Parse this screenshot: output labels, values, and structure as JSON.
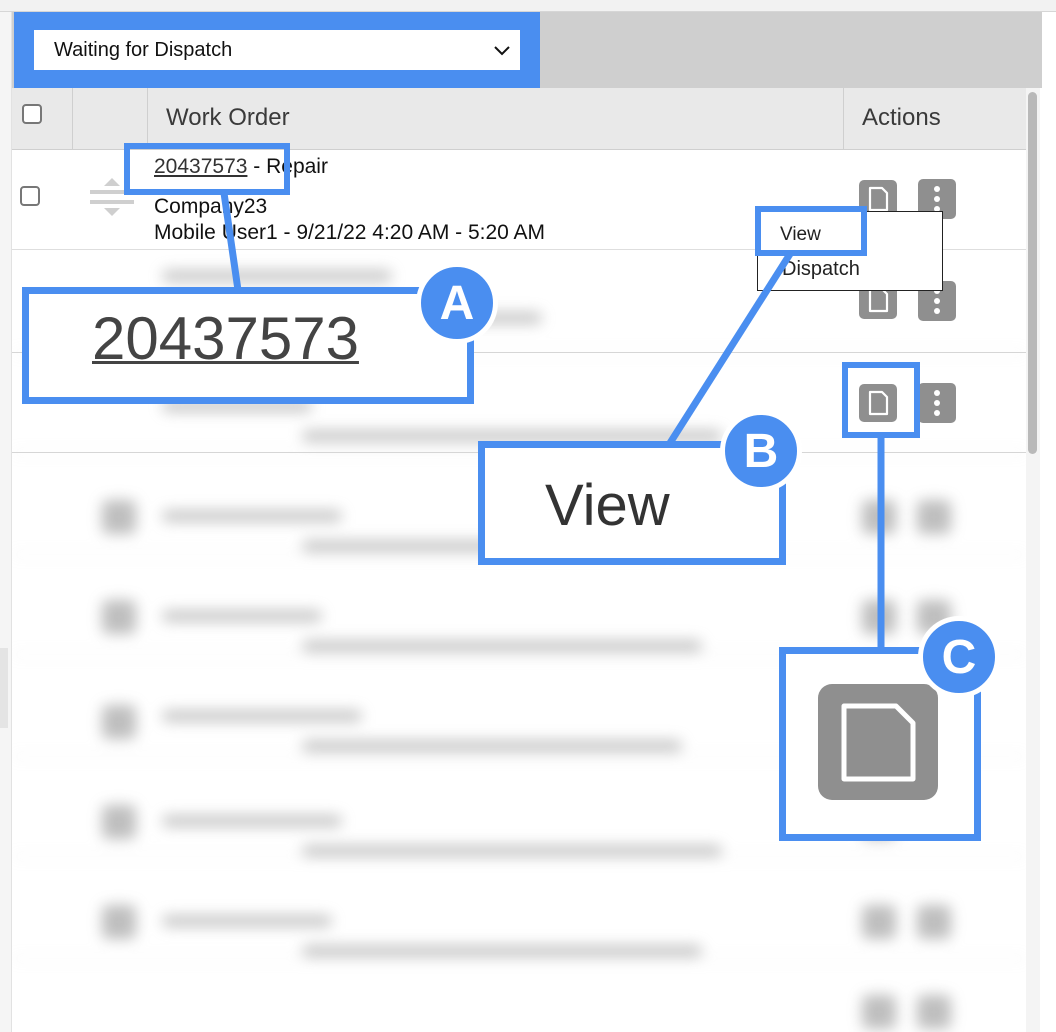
{
  "filter": {
    "selected": "Waiting for Dispatch"
  },
  "table": {
    "headers": {
      "work_order": "Work Order",
      "actions": "Actions"
    },
    "rows": [
      {
        "order_number": "20437573",
        "title_suffix": " - Repair",
        "company": "Company23",
        "schedule": "Mobile User1 - 9/21/22 4:20 AM - 5:20 AM"
      }
    ]
  },
  "menu": {
    "items": [
      "View",
      "Dispatch"
    ]
  },
  "callouts": {
    "a": {
      "badge": "A",
      "label": "20437573"
    },
    "b": {
      "badge": "B",
      "label": "View"
    },
    "c": {
      "badge": "C"
    }
  },
  "icons": [
    "chevron-down-icon",
    "drag-handle-icon",
    "document-icon",
    "kebab-menu-icon"
  ],
  "colors": {
    "accent": "#4a8ef0",
    "action_button": "#8f8f8f",
    "header_bg": "#e9e9e9"
  }
}
